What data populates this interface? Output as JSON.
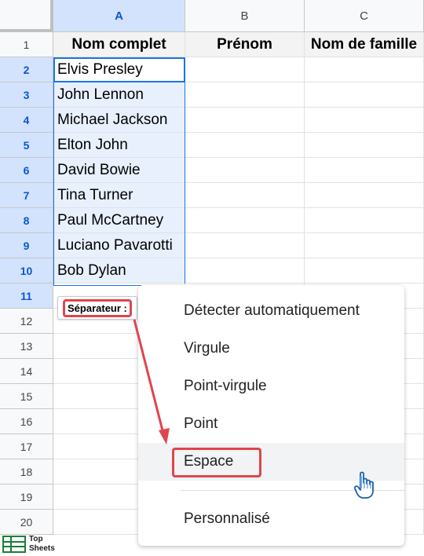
{
  "columns": [
    {
      "label": "A",
      "selected": true
    },
    {
      "label": "B",
      "selected": false
    },
    {
      "label": "C",
      "selected": false
    }
  ],
  "rows": [
    "1",
    "2",
    "3",
    "4",
    "5",
    "6",
    "7",
    "8",
    "9",
    "10",
    "11",
    "12",
    "13",
    "14",
    "15",
    "16",
    "17",
    "18",
    "19",
    "20"
  ],
  "header_row": {
    "a": "Nom complet",
    "b": "Prénom",
    "c": "Nom de famille"
  },
  "names": [
    "Elvis Presley",
    "John Lennon",
    "Michael Jackson",
    "Elton John",
    "David Bowie",
    "Tina Turner",
    "Paul McCartney",
    "Luciano Pavarotti",
    "Bob Dylan"
  ],
  "separator_chip": {
    "label": "Séparateur :"
  },
  "separator_menu": {
    "items": [
      "Détecter automatiquement",
      "Virgule",
      "Point-virgule",
      "Point",
      "Espace",
      "Personnalisé"
    ],
    "hovered": "Espace"
  },
  "logo": {
    "line1": "Top",
    "line2": "Sheets"
  },
  "colors": {
    "selection": "#1a73e8",
    "highlight": "#e0454c",
    "header_selected": "#d3e3fd",
    "logo_green": "#188038"
  }
}
